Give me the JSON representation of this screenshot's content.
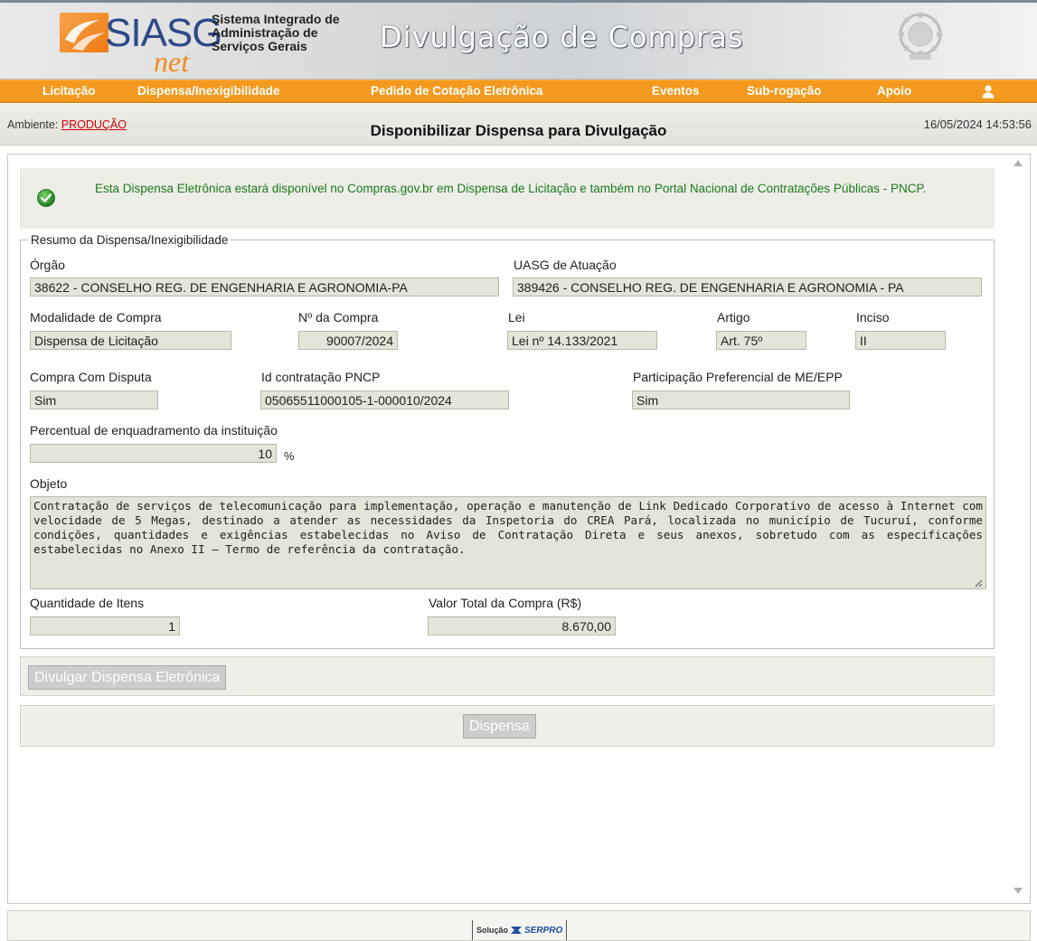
{
  "header": {
    "logo_main": "SIASG",
    "logo_sub": "net",
    "system_name_lines": [
      "Sistema Integrado de",
      "Administração de",
      "Serviços Gerais"
    ],
    "banner_title": "Divulgação de Compras"
  },
  "nav": {
    "items": [
      "Licitação",
      "Dispensa/Inexigibilidade",
      "Pedido de Cotação Eletrônica",
      "Eventos",
      "Sub-rogação",
      "Apoio"
    ],
    "user_icon": "user-icon"
  },
  "status": {
    "ambiente_label": "Ambiente: ",
    "ambiente_value": "PRODUÇÃO",
    "page_title": "Disponibilizar Dispensa para Divulgação",
    "datetime": "16/05/2024 14:53:56"
  },
  "notice": {
    "text": "Esta Dispensa Eletrônica estará disponível no Compras.gov.br em Dispensa de Licitação e também no Portal Nacional de Contratações Públicas - PNCP.",
    "icon": "check-circle-icon",
    "color": "#1a7a1a"
  },
  "resumo": {
    "legend": "Resumo da Dispensa/Inexigibilidade",
    "orgao_label": "Órgão",
    "orgao_value": "38622 - CONSELHO REG. DE ENGENHARIA E AGRONOMIA-PA",
    "uasg_label": "UASG de Atuação",
    "uasg_value": "389426 - CONSELHO REG. DE ENGENHARIA E AGRONOMIA - PA",
    "modalidade_label": "Modalidade de Compra",
    "modalidade_value": "Dispensa de Licitação",
    "numero_label": "Nº da Compra",
    "numero_value": "90007/2024",
    "lei_label": "Lei",
    "lei_value": "Lei nº 14.133/2021",
    "artigo_label": "Artigo",
    "artigo_value": "Art. 75º",
    "inciso_label": "Inciso",
    "inciso_value": "II",
    "disputa_label": "Compra Com Disputa",
    "disputa_value": "Sim",
    "pncp_label": "Id contratação PNCP",
    "pncp_value": "05065511000105-1-000010/2024",
    "me_epp_label": "Participação Preferencial de ME/EPP",
    "me_epp_value": "Sim",
    "percentual_label": "Percentual de enquadramento da instituição",
    "percentual_value": "10",
    "percentual_unit": "%",
    "objeto_label": "Objeto",
    "objeto_value": "Contratação de serviços de telecomunicação para implementação, operação e manutenção de Link Dedicado Corporativo de acesso à Internet com velocidade de 5 Megas, destinado a atender as necessidades da Inspetoria do CREA Pará, localizada no município de Tucuruí, conforme condições, quantidades e exigências estabelecidas no Aviso de Contratação Direta e seus anexos, sobretudo com as especificações estabelecidas no Anexo II – Termo de referência da contratação.",
    "qtd_itens_label": "Quantidade de Itens",
    "qtd_itens_value": "1",
    "valor_total_label": "Valor Total da Compra (R$)",
    "valor_total_value": "8.670,00"
  },
  "buttons": {
    "divulgar": "Divulgar Dispensa Eletrônica",
    "dispensa": "Dispensa"
  },
  "footer": {
    "solucao": "Solução",
    "brand": "SERPRO"
  },
  "colors": {
    "nav_orange": "#f39a1e",
    "field_bg": "#e4e4d8",
    "ambiente_red": "#d00000"
  }
}
